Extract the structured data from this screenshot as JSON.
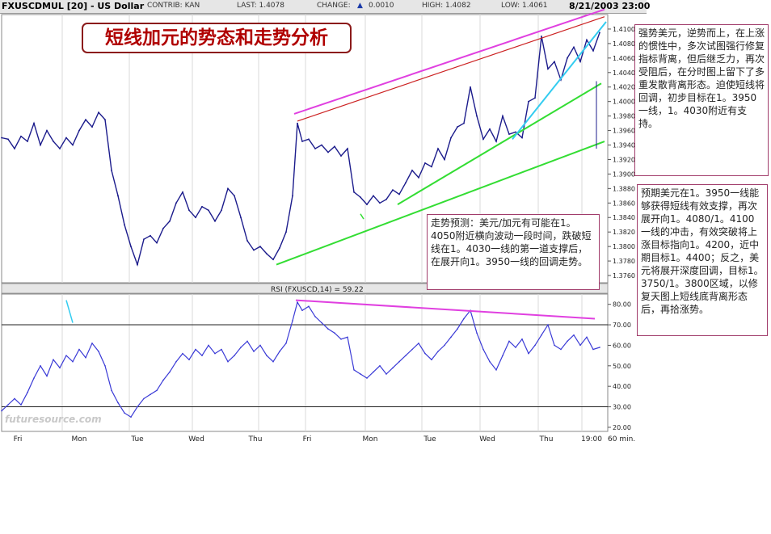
{
  "header": {
    "symbol": "FXUSCDMUL [20] - US Dollar",
    "contrib": "CONTRIB: KAN",
    "last": "LAST: 1.4078",
    "change_label": "CHANGE:",
    "change_value": "0.0010",
    "high": "HIGH: 1.4082",
    "low": "LOW: 1.4061",
    "datetime": "8/21/2003 23:00"
  },
  "title": "短线加元的势态和走势分析",
  "notes": {
    "prediction": "走势预测：美元/加元有可能在1。4050附近横向波动一段时间，跌破短线在1。4030一线的第一道支撑后，在展开向1。3950一线的回调走势。",
    "right_top": "强势美元，逆势而上，在上涨的惯性中，多次试图强行修复指标背离，但后继乏力，再次受阻后，在分时图上留下了多重发散背离形态。迫使短线将回调，初步目标在1。3950一线，1。4030附近有支持。",
    "right_bottom": "预期美元在1。3950一线能够获得短线有效支撑，再次展开向1。4080/1。4100一线的冲击，有效突破将上涨目标指向1。4200，近中期目标1。4400；反之，美元将展开深度回调，目标1。3750/1。3800区域，以修复天图上短线底背离形态后，再拾涨势。"
  },
  "watermark": "futuresource.com",
  "colors": {
    "price_line": "#1c1c8c",
    "rsi_line": "#3a3ad6",
    "resistance_red": "#cc2222",
    "channel_magenta": "#e040e0",
    "trend_green": "#33dd33",
    "trend_cyan": "#33ccf0"
  },
  "chart_data": [
    {
      "type": "line",
      "name": "price",
      "ylim": [
        1.375,
        1.412
      ],
      "y_ticks": [
        "1.4100",
        "1.4080",
        "1.4060",
        "1.4040",
        "1.4020",
        "1.4000",
        "1.3980",
        "1.3960",
        "1.3940",
        "1.3920",
        "1.3900",
        "1.3880",
        "1.3860",
        "1.3840",
        "1.3820",
        "1.3800",
        "1.3780",
        "1.3760"
      ],
      "x_labels": [
        "Fri",
        "Mon",
        "Tue",
        "Wed",
        "Thu",
        "Fri",
        "Mon",
        "Tue",
        "Wed",
        "Thu",
        "19:00"
      ],
      "interval_label": "60 min.",
      "x": [
        0,
        8,
        16,
        24,
        32,
        40,
        48,
        56,
        64,
        72,
        80,
        88,
        96,
        104,
        112,
        120,
        128,
        136,
        144,
        152,
        160,
        168,
        176,
        184,
        192,
        200,
        208,
        216,
        224,
        232,
        240,
        248,
        256,
        264,
        272,
        280,
        288,
        296,
        304,
        312,
        320,
        328,
        336,
        344,
        352,
        360,
        366,
        372,
        380,
        388,
        396,
        404,
        412,
        420,
        428,
        436,
        444,
        452,
        460,
        468,
        476,
        484,
        492,
        500,
        508,
        516,
        524,
        532,
        540,
        548,
        556,
        564,
        572,
        580,
        588,
        596,
        604,
        612,
        620,
        628,
        636,
        644,
        652,
        660,
        668,
        676,
        684,
        692,
        700,
        708,
        716,
        724,
        732,
        740
      ],
      "values": [
        1.395,
        1.3948,
        1.3935,
        1.3952,
        1.3945,
        1.397,
        1.394,
        1.396,
        1.3945,
        1.3935,
        1.395,
        1.394,
        1.396,
        1.3975,
        1.3965,
        1.3985,
        1.3975,
        1.3905,
        1.387,
        1.383,
        1.38,
        1.3775,
        1.381,
        1.3815,
        1.3805,
        1.3825,
        1.3835,
        1.386,
        1.3875,
        1.385,
        1.384,
        1.3855,
        1.385,
        1.3835,
        1.385,
        1.388,
        1.387,
        1.384,
        1.3808,
        1.3795,
        1.38,
        1.379,
        1.3782,
        1.3798,
        1.382,
        1.387,
        1.397,
        1.3945,
        1.3948,
        1.3935,
        1.394,
        1.393,
        1.3938,
        1.3925,
        1.3935,
        1.3875,
        1.3868,
        1.3858,
        1.387,
        1.386,
        1.3865,
        1.3878,
        1.3872,
        1.3888,
        1.3905,
        1.3895,
        1.3915,
        1.391,
        1.3935,
        1.392,
        1.395,
        1.3965,
        1.397,
        1.402,
        1.398,
        1.3948,
        1.3962,
        1.3945,
        1.398,
        1.3955,
        1.3958,
        1.395,
        1.4,
        1.4005,
        1.409,
        1.4045,
        1.4055,
        1.403,
        1.406,
        1.4075,
        1.4055,
        1.4085,
        1.407,
        1.4095,
        1.4078
      ]
    },
    {
      "type": "line",
      "name": "RSI (FXUSCD,14) = 59.22",
      "ylim": [
        18,
        85
      ],
      "y_ticks": [
        "80.00",
        "70.00",
        "60.00",
        "50.00",
        "40.00",
        "30.00",
        "20.00"
      ],
      "levels": [
        70,
        30
      ],
      "x": [
        0,
        8,
        16,
        24,
        32,
        40,
        48,
        56,
        64,
        72,
        80,
        88,
        96,
        104,
        112,
        120,
        128,
        136,
        144,
        152,
        160,
        168,
        176,
        184,
        192,
        200,
        208,
        216,
        224,
        232,
        240,
        248,
        256,
        264,
        272,
        280,
        288,
        296,
        304,
        312,
        320,
        328,
        336,
        344,
        352,
        360,
        366,
        372,
        380,
        388,
        396,
        404,
        412,
        420,
        428,
        436,
        444,
        452,
        460,
        468,
        476,
        484,
        492,
        500,
        508,
        516,
        524,
        532,
        540,
        548,
        556,
        564,
        572,
        580,
        588,
        596,
        604,
        612,
        620,
        628,
        636,
        644,
        652,
        660,
        668,
        676,
        684,
        692,
        700,
        708,
        716,
        724,
        732,
        740
      ],
      "values": [
        28,
        31,
        34,
        31,
        37,
        44,
        50,
        45,
        53,
        49,
        55,
        52,
        58,
        54,
        61,
        57,
        50,
        38,
        32,
        27,
        25,
        30,
        34,
        36,
        38,
        43,
        47,
        52,
        56,
        53,
        58,
        55,
        60,
        56,
        58,
        52,
        55,
        59,
        62,
        57,
        60,
        55,
        52,
        57,
        61,
        72,
        81,
        77,
        79,
        74,
        71,
        68,
        66,
        63,
        64,
        48,
        46,
        44,
        47,
        50,
        46,
        49,
        52,
        55,
        58,
        61,
        56,
        53,
        57,
        60,
        64,
        68,
        73,
        77,
        66,
        58,
        52,
        48,
        55,
        62,
        59,
        63,
        56,
        60,
        65,
        70,
        60,
        58,
        62,
        65,
        60,
        64,
        58,
        59
      ]
    }
  ]
}
